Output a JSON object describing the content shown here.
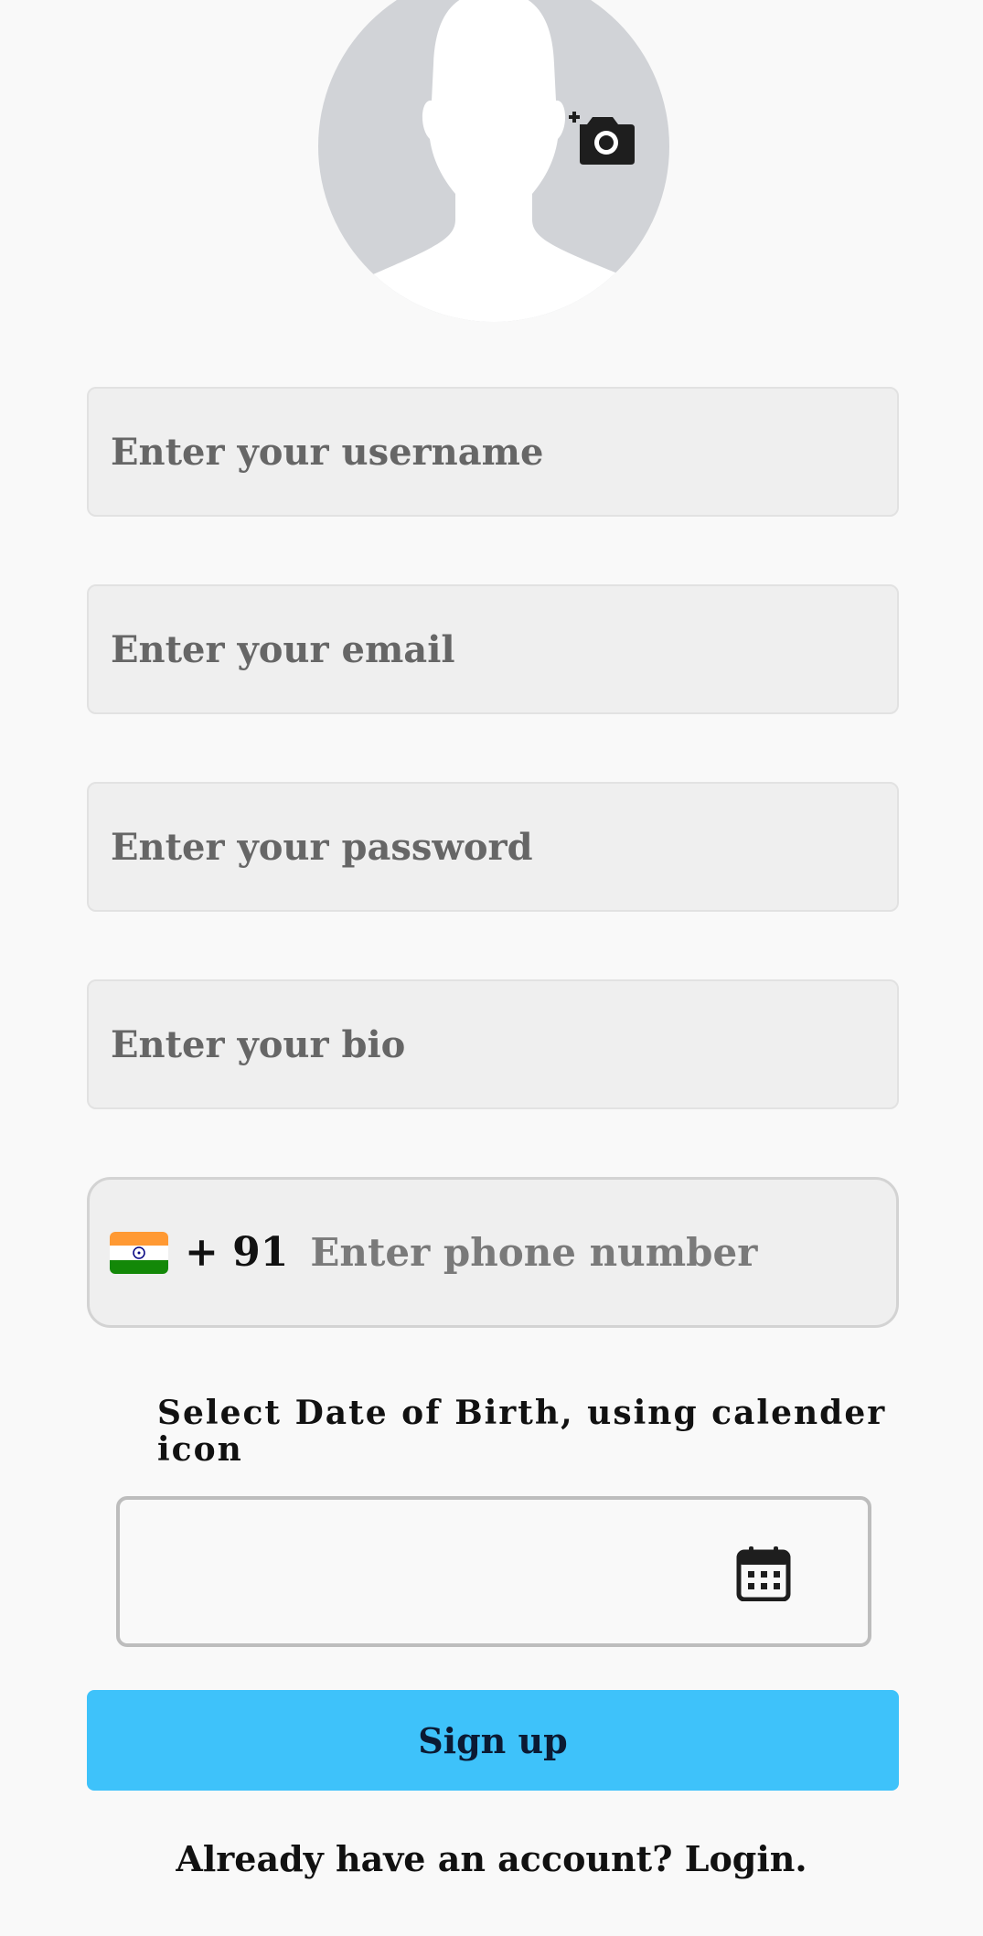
{
  "profile": {
    "avatar_icon": "default-user-avatar",
    "add_photo_icon": "add-a-photo-icon"
  },
  "form": {
    "username_placeholder": "Enter your username",
    "email_placeholder": "Enter your email",
    "password_placeholder": "Enter your password",
    "bio_placeholder": "Enter your bio",
    "phone": {
      "country_flag_icon": "india-flag-icon",
      "dial_code": "+ 91",
      "placeholder": "Enter phone number"
    },
    "dob_label": "Select Date of Birth, using calender icon",
    "dob_value": "",
    "calendar_icon": "calendar-icon",
    "signup_label": "Sign up"
  },
  "footer": {
    "login_text": "Already have an account? Login."
  },
  "colors": {
    "background": "#f9f9f9",
    "input_background": "#efefef",
    "primary_button": "#3ec2fa",
    "avatar_gray": "#d1d3d7"
  }
}
